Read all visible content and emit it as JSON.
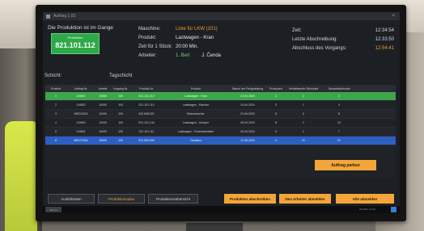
{
  "window": {
    "title": "Auftrag  1.03"
  },
  "production": {
    "status_title": "Die Produktion ist im Gange",
    "box_label": "Produktion",
    "number": "821.101.112",
    "shift_label": "Schicht:",
    "shift_value": "Tagschicht"
  },
  "meta": {
    "maschine_label": "Maschine:",
    "maschine_value": "Linie für LKW (101)",
    "produkt_label": "Produkt:",
    "produkt_value": "Lastwagen - Kran",
    "zeit_label": "Zeit für 1 Stück:",
    "zeit_value": "20:00 Min.",
    "arbeiter_label": "Arbeiter:",
    "arbeiter_1": "1. Bert",
    "arbeiter_2": "J. Čenda"
  },
  "times": {
    "zeit_label": "Zeit:",
    "zeit_value": "12:34:54",
    "letzte_label": "Letzte Abschreibung:",
    "letzte_value": "12:33:50",
    "abschluss_label": "Abschluss des Vorgangs:",
    "abschluss_value": "12:54:41"
  },
  "table": {
    "headers": [
      "Produkt",
      "Auftrag Nr.",
      "Anteile",
      "Vorgang Nr.",
      "Produkt Nr.",
      "Produkt",
      "Datum der Fertigstellung",
      "Produziert",
      "Verbleibende Stückzahl",
      "Gesamtstückzahl"
    ],
    "rows": [
      {
        "style": "green",
        "cells": [
          "1",
          "119821",
          "10000",
          "100",
          "321.101.112",
          "Lastwagen - Kran",
          "21.04.2024",
          "2",
          "1",
          "3"
        ]
      },
      {
        "style": "dark",
        "cells": [
          "2",
          "119822",
          "10000",
          "100",
          "321.101.113",
          "Lastwagen - Mischer",
          "24.04.2024",
          "3",
          "1",
          "4"
        ]
      },
      {
        "style": "dark2",
        "cells": [
          "3",
          "MR211023",
          "10000",
          "100",
          "332.698.021",
          "Betonmischer",
          "21.06.2023",
          "8",
          "0",
          "8"
        ]
      },
      {
        "style": "dark",
        "cells": [
          "4",
          "119834",
          "10000",
          "100",
          "321.101.144",
          "Lastwagen - Kemper",
          "25.04.2024",
          "8",
          "2",
          "10"
        ]
      },
      {
        "style": "dark2",
        "cells": [
          "5",
          "119841",
          "10000",
          "100",
          "321.101.111",
          "Lastwagen - Feuerwehrleiter",
          "29.04.2024",
          "6",
          "1",
          "7"
        ]
      },
      {
        "style": "blue",
        "cells": [
          "6",
          "MR171904",
          "10000",
          "100",
          "321.503.000",
          "Omnibus",
          "17.06.2023",
          "0",
          "21",
          "21"
        ]
      }
    ]
  },
  "buttons": {
    "park": "Auftrag parken",
    "ausfallzeiten": "Ausfallzeiten",
    "produktionsplan": "Produktionsplan",
    "produktionsuebersicht": "Produktionsübersicht",
    "abschreiben": "Produkten abschreiben",
    "arbeiter_abmelden": "Den Arbeiter abmelden",
    "alle_abmelden": "Alle abmelden"
  },
  "taskbar": {
    "start": "W11.11",
    "tray": "DE  ENG  12:34"
  },
  "colors": {
    "green": "#3ea64a",
    "blue": "#2d5fc2",
    "orange": "#f2a53a",
    "screen_bg": "#1c1f24"
  }
}
